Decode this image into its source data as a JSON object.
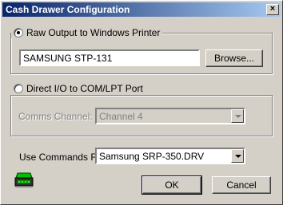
{
  "window": {
    "title": "Cash Drawer Configuration",
    "close_glyph": "×"
  },
  "raw_output": {
    "label": "Raw Output to Windows Printer",
    "selected": true,
    "printer_value": "SAMSUNG STP-131",
    "browse_label": "Browse..."
  },
  "direct_io": {
    "label": "Direct I/O to COM/LPT Port",
    "selected": false,
    "comms_label": "Comms Channel:",
    "comms_value": "Channel 4"
  },
  "commands": {
    "label": "Use Commands For",
    "value": "Samsung SRP-350.DRV"
  },
  "buttons": {
    "ok": "OK",
    "cancel": "Cancel"
  },
  "icons": {
    "drawer": "cash-drawer-icon"
  }
}
